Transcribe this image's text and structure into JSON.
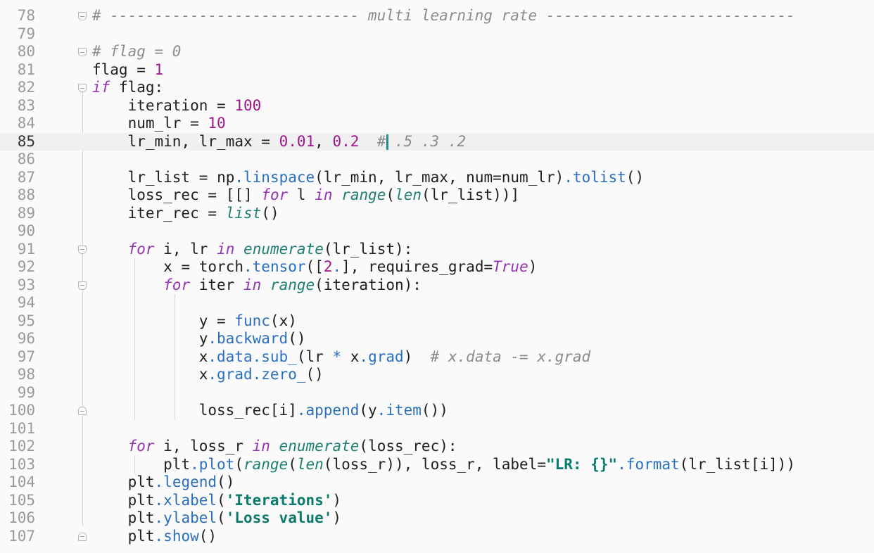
{
  "editor": {
    "current_line": 85,
    "lines": [
      {
        "num": "78",
        "code": "# ---------------------------- multi learning rate ----------------------------"
      },
      {
        "num": "79",
        "code": ""
      },
      {
        "num": "80",
        "code": "# flag = 0"
      },
      {
        "num": "81",
        "code": "flag = 1"
      },
      {
        "num": "82",
        "code": "if flag:"
      },
      {
        "num": "83",
        "code": "    iteration = 100"
      },
      {
        "num": "84",
        "code": "    num_lr = 10"
      },
      {
        "num": "85",
        "code": "    lr_min, lr_max = 0.01, 0.2  # .5 .3 .2"
      },
      {
        "num": "86",
        "code": ""
      },
      {
        "num": "87",
        "code": "    lr_list = np.linspace(lr_min, lr_max, num=num_lr).tolist()"
      },
      {
        "num": "88",
        "code": "    loss_rec = [[] for l in range(len(lr_list))]"
      },
      {
        "num": "89",
        "code": "    iter_rec = list()"
      },
      {
        "num": "90",
        "code": ""
      },
      {
        "num": "91",
        "code": "    for i, lr in enumerate(lr_list):"
      },
      {
        "num": "92",
        "code": "        x = torch.tensor([2.], requires_grad=True)"
      },
      {
        "num": "93",
        "code": "        for iter in range(iteration):"
      },
      {
        "num": "94",
        "code": ""
      },
      {
        "num": "95",
        "code": "            y = func(x)"
      },
      {
        "num": "96",
        "code": "            y.backward()"
      },
      {
        "num": "97",
        "code": "            x.data.sub_(lr * x.grad)  # x.data -= x.grad"
      },
      {
        "num": "98",
        "code": "            x.grad.zero_()"
      },
      {
        "num": "99",
        "code": ""
      },
      {
        "num": "100",
        "code": "            loss_rec[i].append(y.item())"
      },
      {
        "num": "101",
        "code": ""
      },
      {
        "num": "102",
        "code": "    for i, loss_r in enumerate(loss_rec):"
      },
      {
        "num": "103",
        "code": "        plt.plot(range(len(loss_r)), loss_r, label=\"LR: {}\".format(lr_list[i]))"
      },
      {
        "num": "104",
        "code": "    plt.legend()"
      },
      {
        "num": "105",
        "code": "    plt.xlabel('Iterations')"
      },
      {
        "num": "106",
        "code": "    plt.ylabel('Loss value')"
      },
      {
        "num": "107",
        "code": "    plt.show()"
      }
    ]
  },
  "colors": {
    "background": "#fafafa",
    "current_line": "#f0f0f0",
    "keyword": "#9333b3",
    "number": "#a0148c",
    "function": "#2a6fbd",
    "comment": "#8c8c8c",
    "string": "#0a7a6a",
    "caret": "#1f8c8c"
  }
}
